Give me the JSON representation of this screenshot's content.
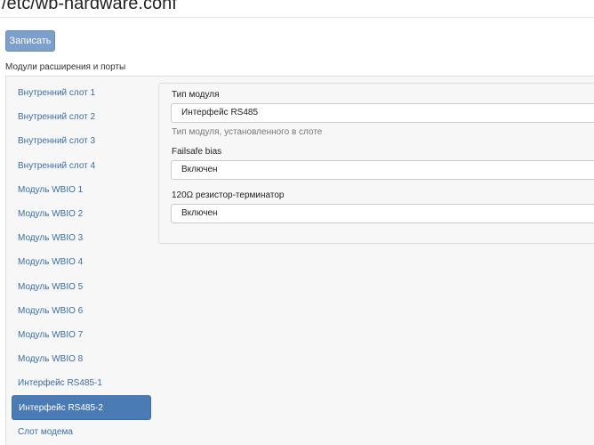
{
  "header": {
    "title": "/etc/wb-hardware.conf"
  },
  "toolbar": {
    "save_label": "Записать"
  },
  "section": {
    "label": "Модули расширения и порты"
  },
  "nav": {
    "items": [
      {
        "label": "Внутренний слот 1"
      },
      {
        "label": "Внутренний слот 2"
      },
      {
        "label": "Внутренний слот 3"
      },
      {
        "label": "Внутренний слот 4"
      },
      {
        "label": "Модуль WBIO 1"
      },
      {
        "label": "Модуль WBIO 2"
      },
      {
        "label": "Модуль WBIO 3"
      },
      {
        "label": "Модуль WBIO 4"
      },
      {
        "label": "Модуль WBIO 5"
      },
      {
        "label": "Модуль WBIO 6"
      },
      {
        "label": "Модуль WBIO 7"
      },
      {
        "label": "Модуль WBIO 8"
      },
      {
        "label": "Интерфейс RS485-1"
      },
      {
        "label": "Интерфейс RS485-2"
      },
      {
        "label": "Слот модема"
      }
    ],
    "active_label": "Интерфейс RS485-2"
  },
  "form": {
    "module_type": {
      "label": "Тип модуля",
      "value": "Интерфейс RS485",
      "help": "Тип модуля, установленного в слоте"
    },
    "failsafe": {
      "label": "Failsafe bias",
      "value": "Включен"
    },
    "terminator": {
      "label": "120Ω резистор-терминатор",
      "value": "Включен"
    }
  },
  "colors": {
    "accent": "#4a7bb5",
    "link": "#3a6ea5",
    "button": "#7d9fcb"
  }
}
